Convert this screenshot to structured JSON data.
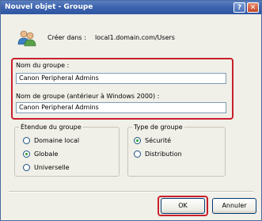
{
  "window": {
    "title": "Nouvel objet - Groupe",
    "help_label": "?",
    "close_label": "✕"
  },
  "header": {
    "created_in_label": "Créer dans :",
    "created_in_value": "local1.domain.com/Users",
    "icon": "users-group-icon"
  },
  "group_name": {
    "label": "Nom du groupe :",
    "value": "Canon Peripheral Admins"
  },
  "group_name_pre2000": {
    "label": "Nom de groupe (antérieur à Windows 2000) :",
    "value": "Canon Peripheral Admins"
  },
  "scope": {
    "legend": "Étendue du groupe",
    "options": [
      {
        "label": "Domaine local",
        "checked": false
      },
      {
        "label": "Globale",
        "checked": true
      },
      {
        "label": "Universelle",
        "checked": false
      }
    ]
  },
  "type": {
    "legend": "Type de groupe",
    "options": [
      {
        "label": "Sécurité",
        "checked": true
      },
      {
        "label": "Distribution",
        "checked": false
      }
    ]
  },
  "buttons": {
    "ok": "OK",
    "cancel": "Annuler"
  },
  "colors": {
    "highlight": "#c8202c",
    "titlebar": "#3e64ae"
  }
}
